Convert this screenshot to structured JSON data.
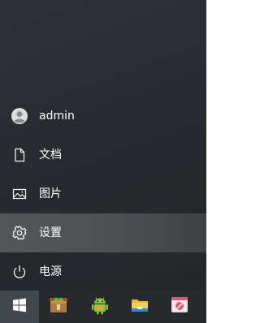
{
  "start_menu": {
    "items": [
      {
        "key": "account",
        "label": "admin",
        "icon": "user-avatar-icon"
      },
      {
        "key": "documents",
        "label": "文档",
        "icon": "document-icon"
      },
      {
        "key": "pictures",
        "label": "图片",
        "icon": "picture-icon"
      },
      {
        "key": "settings",
        "label": "设置",
        "icon": "gear-icon",
        "highlighted": true
      },
      {
        "key": "power",
        "label": "电源",
        "icon": "power-icon"
      }
    ]
  },
  "taskbar": {
    "start_icon": "windows-logo-icon",
    "apps": [
      {
        "icon": "package-app-icon"
      },
      {
        "icon": "android-app-icon"
      },
      {
        "icon": "file-explorer-icon"
      },
      {
        "icon": "image-app-icon"
      }
    ]
  },
  "colors": {
    "background": "#2a2e32",
    "highlight": "#505457",
    "taskbar": "#262a2d",
    "start_button": "#40474d",
    "text": "#ffffff"
  }
}
